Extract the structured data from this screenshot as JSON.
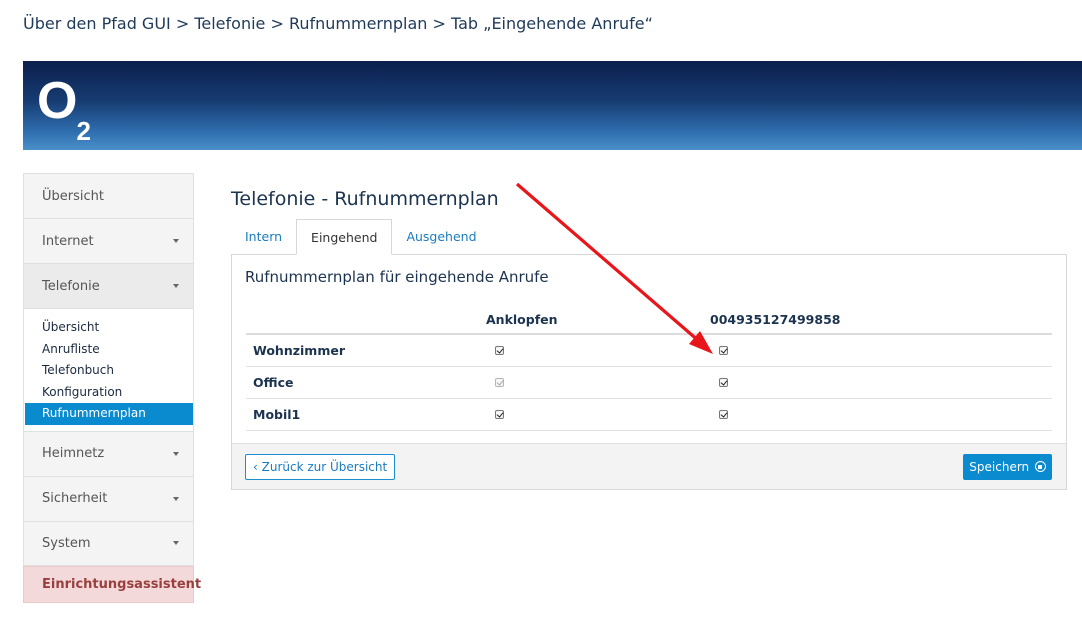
{
  "caption": "Über den Pfad GUI > Telefonie > Rufnummernplan > Tab „Eingehende Anrufe“",
  "logo": {
    "letter": "O",
    "sub": "2"
  },
  "colors": {
    "accent": "#0a8bd0",
    "wizard_bg": "#f3d9d9",
    "wizard_text": "#9a3f3f",
    "arrow": "#e8161b"
  },
  "sidebar": {
    "items": [
      {
        "label": "Übersicht"
      },
      {
        "label": "Internet"
      },
      {
        "label": "Telefonie"
      },
      {
        "label": "Heimnetz"
      },
      {
        "label": "Sicherheit"
      },
      {
        "label": "System"
      }
    ],
    "subitems": [
      {
        "label": "Übersicht"
      },
      {
        "label": "Anrufliste"
      },
      {
        "label": "Telefonbuch"
      },
      {
        "label": "Konfiguration"
      },
      {
        "label": "Rufnummernplan"
      }
    ],
    "wizard": "Einrichtungsassistent"
  },
  "main": {
    "title": "Telefonie - Rufnummernplan",
    "tabs": [
      {
        "label": "Intern"
      },
      {
        "label": "Eingehend"
      },
      {
        "label": "Ausgehend"
      }
    ],
    "panel_title": "Rufnummernplan für eingehende Anrufe",
    "columns": [
      "Anklopfen",
      "004935127499858"
    ],
    "rows": [
      {
        "label": "Wohnzimmer",
        "anklopfen": true,
        "number": true
      },
      {
        "label": "Office",
        "anklopfen": true,
        "number": true,
        "anklopfen_disabled": true
      },
      {
        "label": "Mobil1",
        "anklopfen": true,
        "number": true
      }
    ],
    "back_button": "‹ Zurück zur Übersicht",
    "save_button": "Speichern"
  }
}
